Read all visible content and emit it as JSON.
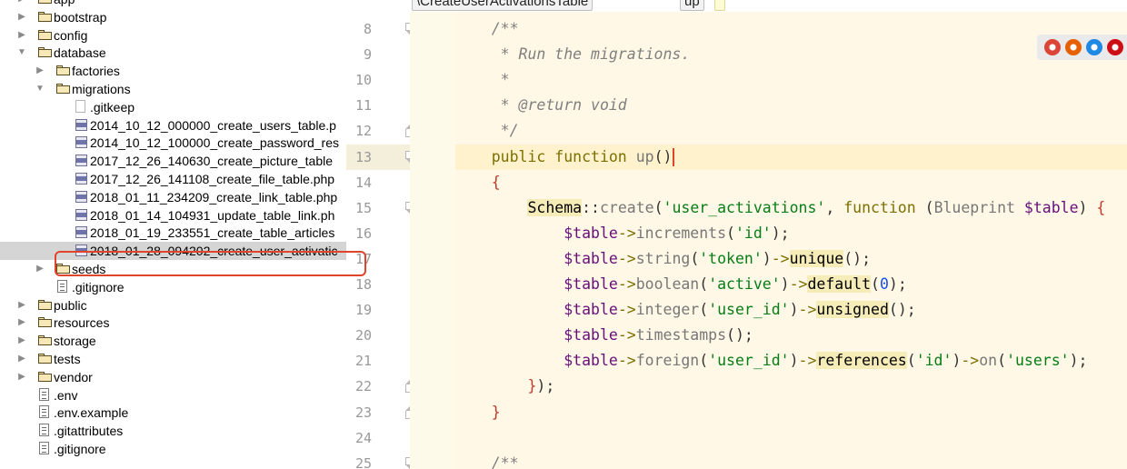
{
  "tree": {
    "items": [
      {
        "label": "app",
        "kind": "folder",
        "depth": 0,
        "expanded": false
      },
      {
        "label": "bootstrap",
        "kind": "folder",
        "depth": 0,
        "expanded": false
      },
      {
        "label": "config",
        "kind": "folder",
        "depth": 0,
        "expanded": false
      },
      {
        "label": "database",
        "kind": "folder",
        "depth": 0,
        "expanded": true
      },
      {
        "label": "factories",
        "kind": "folder",
        "depth": 1,
        "expanded": false
      },
      {
        "label": "migrations",
        "kind": "folder",
        "depth": 1,
        "expanded": true
      },
      {
        "label": ".gitkeep",
        "kind": "blank",
        "depth": 2
      },
      {
        "label": "2014_10_12_000000_create_users_table.p",
        "kind": "php",
        "depth": 2
      },
      {
        "label": "2014_10_12_100000_create_password_res",
        "kind": "php",
        "depth": 2
      },
      {
        "label": "2017_12_26_140630_create_picture_table",
        "kind": "php",
        "depth": 2
      },
      {
        "label": "2017_12_26_141108_create_file_table.php",
        "kind": "php",
        "depth": 2
      },
      {
        "label": "2018_01_11_234209_create_link_table.php",
        "kind": "php",
        "depth": 2
      },
      {
        "label": "2018_01_14_104931_update_table_link.ph",
        "kind": "php",
        "depth": 2
      },
      {
        "label": "2018_01_19_233551_create_table_articles",
        "kind": "php",
        "depth": 2
      },
      {
        "label": "2018_01_28_094202_create_user_activatic",
        "kind": "php",
        "depth": 2,
        "selected": true
      },
      {
        "label": "seeds",
        "kind": "folder",
        "depth": 1,
        "expanded": false
      },
      {
        "label": ".gitignore",
        "kind": "text",
        "depth": 1
      },
      {
        "label": "public",
        "kind": "folder",
        "depth": 0,
        "expanded": false
      },
      {
        "label": "resources",
        "kind": "folder",
        "depth": 0,
        "expanded": false
      },
      {
        "label": "storage",
        "kind": "folder",
        "depth": 0,
        "expanded": false
      },
      {
        "label": "tests",
        "kind": "folder",
        "depth": 0,
        "expanded": false
      },
      {
        "label": "vendor",
        "kind": "folder",
        "depth": 0,
        "expanded": false
      },
      {
        "label": ".env",
        "kind": "text",
        "depth": 0
      },
      {
        "label": ".env.example",
        "kind": "text",
        "depth": 0
      },
      {
        "label": ".gitattributes",
        "kind": "text",
        "depth": 0
      },
      {
        "label": ".gitignore",
        "kind": "text",
        "depth": 0
      }
    ]
  },
  "breadcrumbs": [
    "\\CreateUserActivationsTable",
    "up"
  ],
  "editor": {
    "current_line": 13,
    "lines": [
      {
        "n": "8",
        "fold": "down",
        "tokens": [
          {
            "t": "    /**",
            "c": "c-comment"
          }
        ]
      },
      {
        "n": "9",
        "tokens": [
          {
            "t": "     * Run the migrations.",
            "c": "c-comment"
          }
        ]
      },
      {
        "n": "10",
        "tokens": [
          {
            "t": "     *",
            "c": "c-comment"
          }
        ]
      },
      {
        "n": "11",
        "tokens": [
          {
            "t": "     * @return void",
            "c": "c-comment"
          }
        ]
      },
      {
        "n": "12",
        "fold": "up",
        "tokens": [
          {
            "t": "     */",
            "c": "c-comment"
          }
        ]
      },
      {
        "n": "13",
        "fold": "down",
        "caret": true,
        "tokens": [
          {
            "t": "    public function ",
            "c": "c-kw"
          },
          {
            "t": "up",
            "c": "c-fn"
          },
          {
            "t": "()",
            "c": "c-plain"
          }
        ]
      },
      {
        "n": "14",
        "tokens": [
          {
            "t": "    {",
            "c": "c-brace"
          }
        ]
      },
      {
        "n": "15",
        "fold": "down",
        "tokens": [
          {
            "t": "        ",
            "c": "c-plain"
          },
          {
            "t": "Schema",
            "c": "c-class"
          },
          {
            "t": "::",
            "c": "c-plain"
          },
          {
            "t": "create",
            "c": "c-fn"
          },
          {
            "t": "(",
            "c": "c-plain"
          },
          {
            "t": "'user_activations'",
            "c": "c-str"
          },
          {
            "t": ", ",
            "c": "c-plain"
          },
          {
            "t": "function",
            "c": "c-kw"
          },
          {
            "t": " (",
            "c": "c-plain"
          },
          {
            "t": "Blueprint",
            "c": "c-fn"
          },
          {
            "t": " ",
            "c": "c-plain"
          },
          {
            "t": "$table",
            "c": "c-var"
          },
          {
            "t": ") ",
            "c": "c-plain"
          },
          {
            "t": "{",
            "c": "c-brace"
          }
        ]
      },
      {
        "n": "16",
        "tokens": [
          {
            "t": "            ",
            "c": "c-plain"
          },
          {
            "t": "$table",
            "c": "c-var"
          },
          {
            "t": "->",
            "c": "c-kw"
          },
          {
            "t": "increments",
            "c": "c-fn"
          },
          {
            "t": "(",
            "c": "c-plain"
          },
          {
            "t": "'id'",
            "c": "c-str"
          },
          {
            "t": ");",
            "c": "c-plain"
          }
        ]
      },
      {
        "n": "17",
        "tokens": [
          {
            "t": "            ",
            "c": "c-plain"
          },
          {
            "t": "$table",
            "c": "c-var"
          },
          {
            "t": "->",
            "c": "c-kw"
          },
          {
            "t": "string",
            "c": "c-fn"
          },
          {
            "t": "(",
            "c": "c-plain"
          },
          {
            "t": "'token'",
            "c": "c-str"
          },
          {
            "t": ")",
            "c": "c-plain"
          },
          {
            "t": "->",
            "c": "c-kw"
          },
          {
            "t": "unique",
            "c": "c-method"
          },
          {
            "t": "();",
            "c": "c-plain"
          }
        ]
      },
      {
        "n": "18",
        "tokens": [
          {
            "t": "            ",
            "c": "c-plain"
          },
          {
            "t": "$table",
            "c": "c-var"
          },
          {
            "t": "->",
            "c": "c-kw"
          },
          {
            "t": "boolean",
            "c": "c-fn"
          },
          {
            "t": "(",
            "c": "c-plain"
          },
          {
            "t": "'active'",
            "c": "c-str"
          },
          {
            "t": ")",
            "c": "c-plain"
          },
          {
            "t": "->",
            "c": "c-kw"
          },
          {
            "t": "default",
            "c": "c-method"
          },
          {
            "t": "(",
            "c": "c-plain"
          },
          {
            "t": "0",
            "c": "c-num"
          },
          {
            "t": ");",
            "c": "c-plain"
          }
        ]
      },
      {
        "n": "19",
        "tokens": [
          {
            "t": "            ",
            "c": "c-plain"
          },
          {
            "t": "$table",
            "c": "c-var"
          },
          {
            "t": "->",
            "c": "c-kw"
          },
          {
            "t": "integer",
            "c": "c-fn"
          },
          {
            "t": "(",
            "c": "c-plain"
          },
          {
            "t": "'user_id'",
            "c": "c-str"
          },
          {
            "t": ")",
            "c": "c-plain"
          },
          {
            "t": "->",
            "c": "c-kw"
          },
          {
            "t": "unsigned",
            "c": "c-method"
          },
          {
            "t": "();",
            "c": "c-plain"
          }
        ]
      },
      {
        "n": "20",
        "tokens": [
          {
            "t": "            ",
            "c": "c-plain"
          },
          {
            "t": "$table",
            "c": "c-var"
          },
          {
            "t": "->",
            "c": "c-kw"
          },
          {
            "t": "timestamps",
            "c": "c-fn"
          },
          {
            "t": "();",
            "c": "c-plain"
          }
        ]
      },
      {
        "n": "21",
        "tokens": [
          {
            "t": "            ",
            "c": "c-plain"
          },
          {
            "t": "$table",
            "c": "c-var"
          },
          {
            "t": "->",
            "c": "c-kw"
          },
          {
            "t": "foreign",
            "c": "c-fn"
          },
          {
            "t": "(",
            "c": "c-plain"
          },
          {
            "t": "'user_id'",
            "c": "c-str"
          },
          {
            "t": ")",
            "c": "c-plain"
          },
          {
            "t": "->",
            "c": "c-kw"
          },
          {
            "t": "references",
            "c": "c-method"
          },
          {
            "t": "(",
            "c": "c-plain"
          },
          {
            "t": "'id'",
            "c": "c-str"
          },
          {
            "t": ")",
            "c": "c-plain"
          },
          {
            "t": "->",
            "c": "c-kw"
          },
          {
            "t": "on",
            "c": "c-fn"
          },
          {
            "t": "(",
            "c": "c-plain"
          },
          {
            "t": "'users'",
            "c": "c-str"
          },
          {
            "t": ");",
            "c": "c-plain"
          }
        ]
      },
      {
        "n": "22",
        "fold": "up",
        "tokens": [
          {
            "t": "        ",
            "c": "c-plain"
          },
          {
            "t": "}",
            "c": "c-brace"
          },
          {
            "t": ");",
            "c": "c-plain"
          }
        ]
      },
      {
        "n": "23",
        "fold": "up",
        "tokens": [
          {
            "t": "    }",
            "c": "c-brace"
          }
        ]
      },
      {
        "n": "24",
        "tokens": []
      },
      {
        "n": "25",
        "fold": "down",
        "tokens": [
          {
            "t": "    /**",
            "c": "c-comment"
          }
        ]
      }
    ]
  },
  "browser_icons": [
    {
      "name": "chrome-icon",
      "color": "#db4437"
    },
    {
      "name": "firefox-icon",
      "color": "#e66000"
    },
    {
      "name": "safari-icon",
      "color": "#1e88e5"
    },
    {
      "name": "opera-icon",
      "color": "#cc0f16"
    }
  ]
}
